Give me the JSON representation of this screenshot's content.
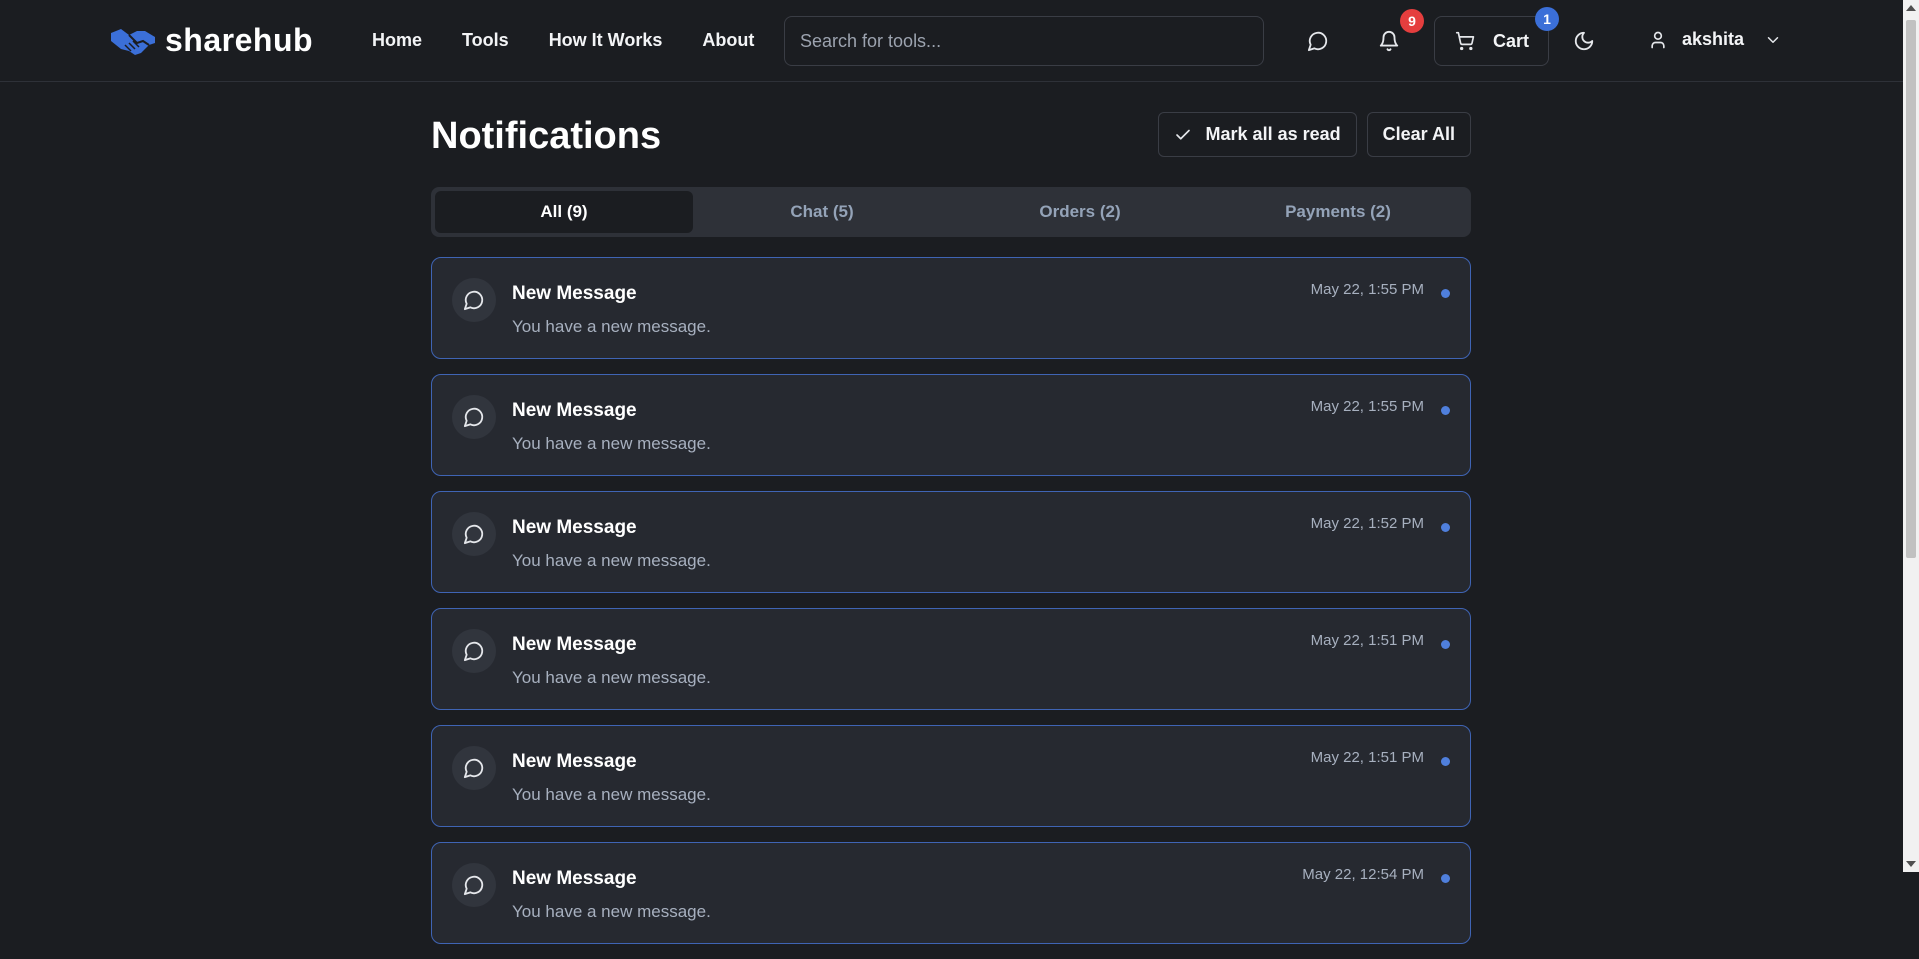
{
  "brand": {
    "name": "sharehub",
    "accent": "#3b6fd8"
  },
  "nav": {
    "items": [
      {
        "label": "Home"
      },
      {
        "label": "Tools"
      },
      {
        "label": "How It Works"
      },
      {
        "label": "About"
      }
    ]
  },
  "search": {
    "placeholder": "Search for tools..."
  },
  "header": {
    "chat_icon": "chat-bubble-icon",
    "notifications_badge": "9",
    "cart_label": "Cart",
    "cart_badge": "1",
    "theme_icon": "moon-icon",
    "user_name": "akshita"
  },
  "page": {
    "title": "Notifications",
    "mark_all_label": "Mark all as read",
    "clear_all_label": "Clear All"
  },
  "tabs": [
    {
      "label": "All (9)",
      "active": true
    },
    {
      "label": "Chat (5)",
      "active": false
    },
    {
      "label": "Orders (2)",
      "active": false
    },
    {
      "label": "Payments (2)",
      "active": false
    }
  ],
  "notifications": [
    {
      "title": "New Message",
      "message": "You have a new message.",
      "time": "May 22, 1:55 PM",
      "unread": true
    },
    {
      "title": "New Message",
      "message": "You have a new message.",
      "time": "May 22, 1:55 PM",
      "unread": true
    },
    {
      "title": "New Message",
      "message": "You have a new message.",
      "time": "May 22, 1:52 PM",
      "unread": true
    },
    {
      "title": "New Message",
      "message": "You have a new message.",
      "time": "May 22, 1:51 PM",
      "unread": true
    },
    {
      "title": "New Message",
      "message": "You have a new message.",
      "time": "May 22, 1:51 PM",
      "unread": true
    },
    {
      "title": "New Message",
      "message": "You have a new message.",
      "time": "May 22, 12:54 PM",
      "unread": true
    }
  ]
}
